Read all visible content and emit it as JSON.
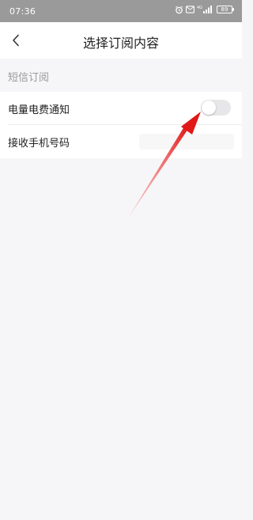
{
  "status_bar": {
    "time": "07:36",
    "battery": "89"
  },
  "nav": {
    "back_icon": "chevron-left-icon",
    "title": "选择订阅内容"
  },
  "section": {
    "title": "短信订阅"
  },
  "rows": [
    {
      "label": "电量电费通知",
      "toggle_on": false
    },
    {
      "label": "接收手机号码",
      "input_value": "",
      "input_placeholder": ""
    }
  ],
  "colors": {
    "annotation_arrow": "#e02020",
    "status_bar_bg": "#9a9a9a",
    "page_bg": "#f6f6f8"
  }
}
